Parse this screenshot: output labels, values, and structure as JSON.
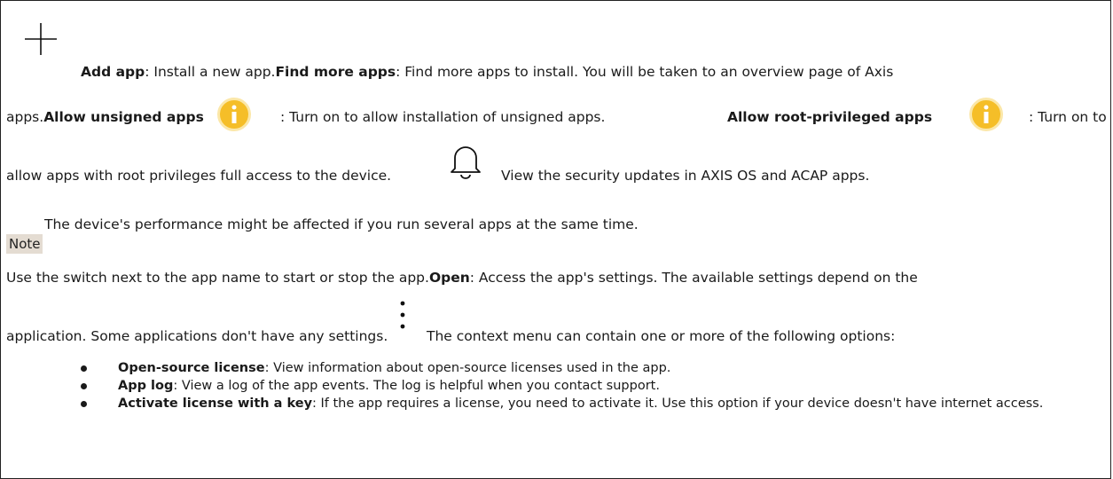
{
  "apps": {
    "add_app_label": "Add app",
    "add_app_desc": ": Install a new app.",
    "find_more_label": "Find more apps",
    "find_more_desc": ": Find more apps to install. You will be taken to an overview page of Axis",
    "find_more_desc2": "apps.",
    "allow_unsigned_label": "Allow unsigned apps",
    "allow_unsigned_desc": ": Turn on to allow installation of unsigned apps.",
    "allow_root_label": "Allow root-privileged apps",
    "allow_root_desc": ": Turn on to",
    "allow_root_desc2": "allow apps with root privileges full access to the device.",
    "security_desc": "View the security updates in AXIS OS and ACAP apps.",
    "note_label": "Note",
    "note_text": "The device's performance might be affected if you run several apps at the same time.",
    "switch_desc": "Use the switch next to the app name to start or stop the app.",
    "open_label": "Open",
    "open_desc": ": Access the app's settings. The available settings depend on the",
    "open_desc2": "application. Some applications don't have any settings.",
    "context_desc": "The context menu can contain one or more of the following options:",
    "options": [
      {
        "label": "Open-source license",
        "desc": ": View information about open-source licenses used in the app."
      },
      {
        "label": "App log",
        "desc": ": View a log of the app events. The log is helpful when you contact support."
      },
      {
        "label": "Activate license with a key",
        "desc": ": If the app requires a license, you need to activate it. Use this option if your device doesn't have internet access."
      }
    ]
  },
  "icons": {
    "add": "plus-icon",
    "info": "info-icon",
    "bell": "bell-icon",
    "menu": "kebab-menu-icon",
    "info_color": "#f5be28"
  }
}
